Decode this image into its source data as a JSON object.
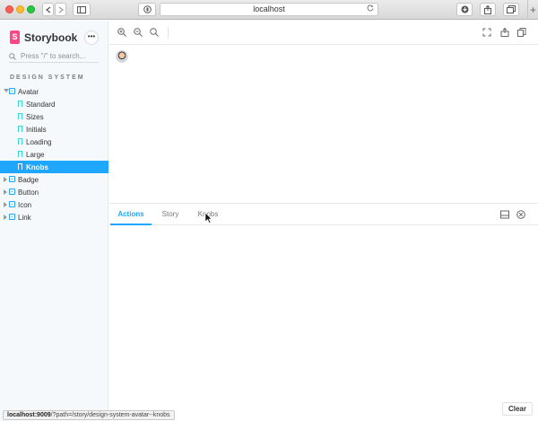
{
  "browser": {
    "url": "localhost",
    "reload_icon": "reload-icon",
    "status_url_host": "localhost:9009",
    "status_url_path": "/?path=/story/design-system-avatar--knobs"
  },
  "sidebar": {
    "brand": "Storybook",
    "brand_letter": "S",
    "menu_label": "•••",
    "search_placeholder": "Press \"/\" to search...",
    "section": "DESIGN SYSTEM",
    "groups": [
      {
        "label": "Avatar",
        "expanded": true,
        "stories": [
          "Standard",
          "Sizes",
          "Initials",
          "Loading",
          "Large",
          "Knobs"
        ]
      },
      {
        "label": "Badge",
        "expanded": false
      },
      {
        "label": "Button",
        "expanded": false
      },
      {
        "label": "Icon",
        "expanded": false
      },
      {
        "label": "Link",
        "expanded": false
      }
    ],
    "selected_story": "Knobs"
  },
  "panel": {
    "tabs": [
      "Actions",
      "Story",
      "Knobs"
    ],
    "active_tab": "Actions",
    "clear_label": "Clear"
  },
  "colors": {
    "accent": "#1ea7fd",
    "brand": "#ff4785"
  }
}
